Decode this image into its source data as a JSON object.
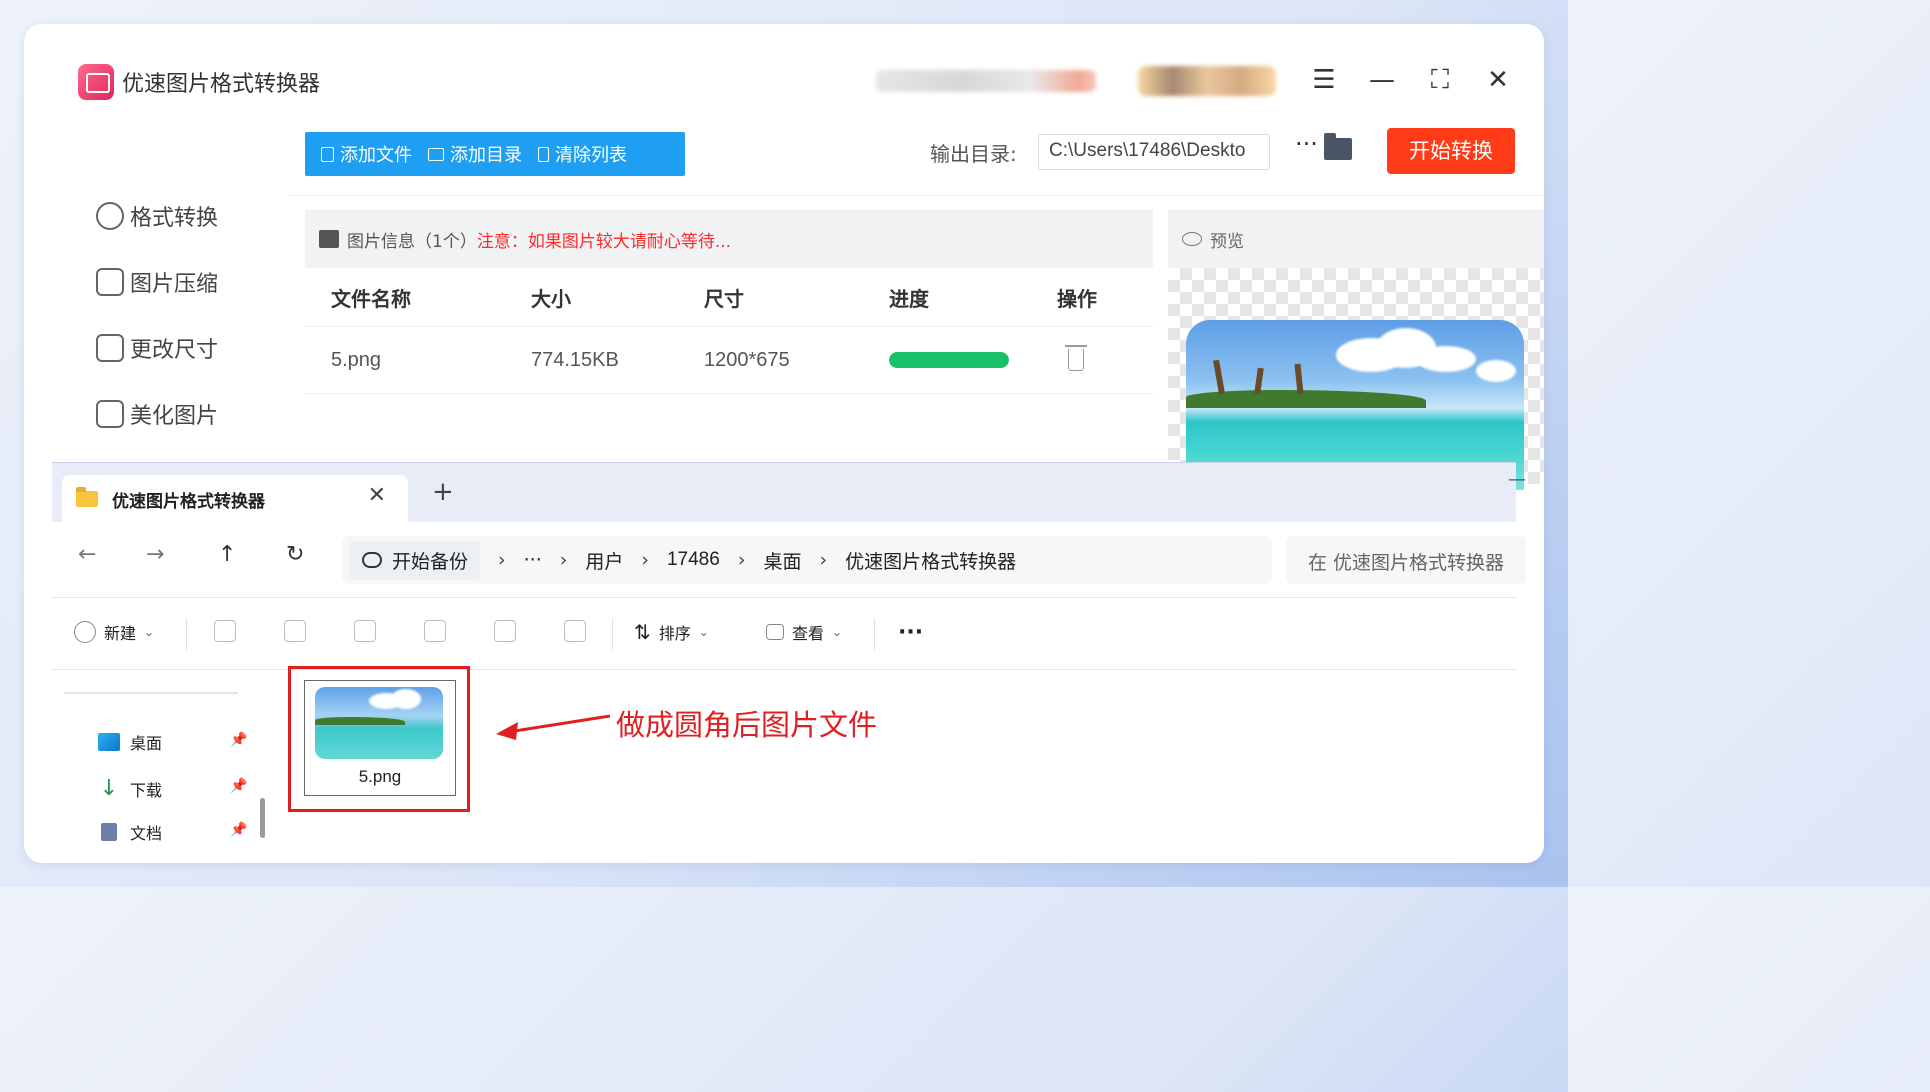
{
  "app": {
    "title": "优速图片格式转换器",
    "sidebar": [
      {
        "label": "格式转换",
        "icon": "exchange-icon"
      },
      {
        "label": "图片压缩",
        "icon": "compress-icon"
      },
      {
        "label": "更改尺寸",
        "icon": "resize-icon"
      },
      {
        "label": "美化图片",
        "icon": "beautify-icon"
      }
    ],
    "toolbar": {
      "add_file": "添加文件",
      "add_dir": "添加目录",
      "clear_list": "清除列表",
      "output_label": "输出目录:",
      "output_value": "C:\\Users\\17486\\Deskto",
      "more": "···",
      "start": "开始转换"
    },
    "info": {
      "title": "图片信息（1个）",
      "warning": "注意：如果图片较大请耐心等待..."
    },
    "table": {
      "headers": [
        "文件名称",
        "大小",
        "尺寸",
        "进度",
        "操作"
      ],
      "rows": [
        {
          "name": "5.png",
          "size": "774.15KB",
          "dims": "1200*675",
          "progress": 1.0
        }
      ]
    },
    "preview": {
      "title": "预览"
    },
    "colors": {
      "accent": "#1e9ff2",
      "start": "#ff3b18",
      "progress": "#18c06a"
    }
  },
  "explorer": {
    "tab_title": "优速图片格式转换器",
    "breadcrumb": {
      "backup": "开始备份",
      "ellipsis": "···",
      "items": [
        "用户",
        "17486",
        "桌面",
        "优速图片格式转换器"
      ]
    },
    "search_placeholder": "在 优速图片格式转换器",
    "commands": {
      "new": "新建",
      "sort": "排序",
      "view": "查看",
      "more": "···"
    },
    "nav": [
      {
        "label": "桌面",
        "icon": "desktop-icon"
      },
      {
        "label": "下载",
        "icon": "download-icon"
      },
      {
        "label": "文档",
        "icon": "document-icon"
      }
    ],
    "file": {
      "name": "5.png"
    },
    "annotation": "做成圆角后图片文件"
  }
}
